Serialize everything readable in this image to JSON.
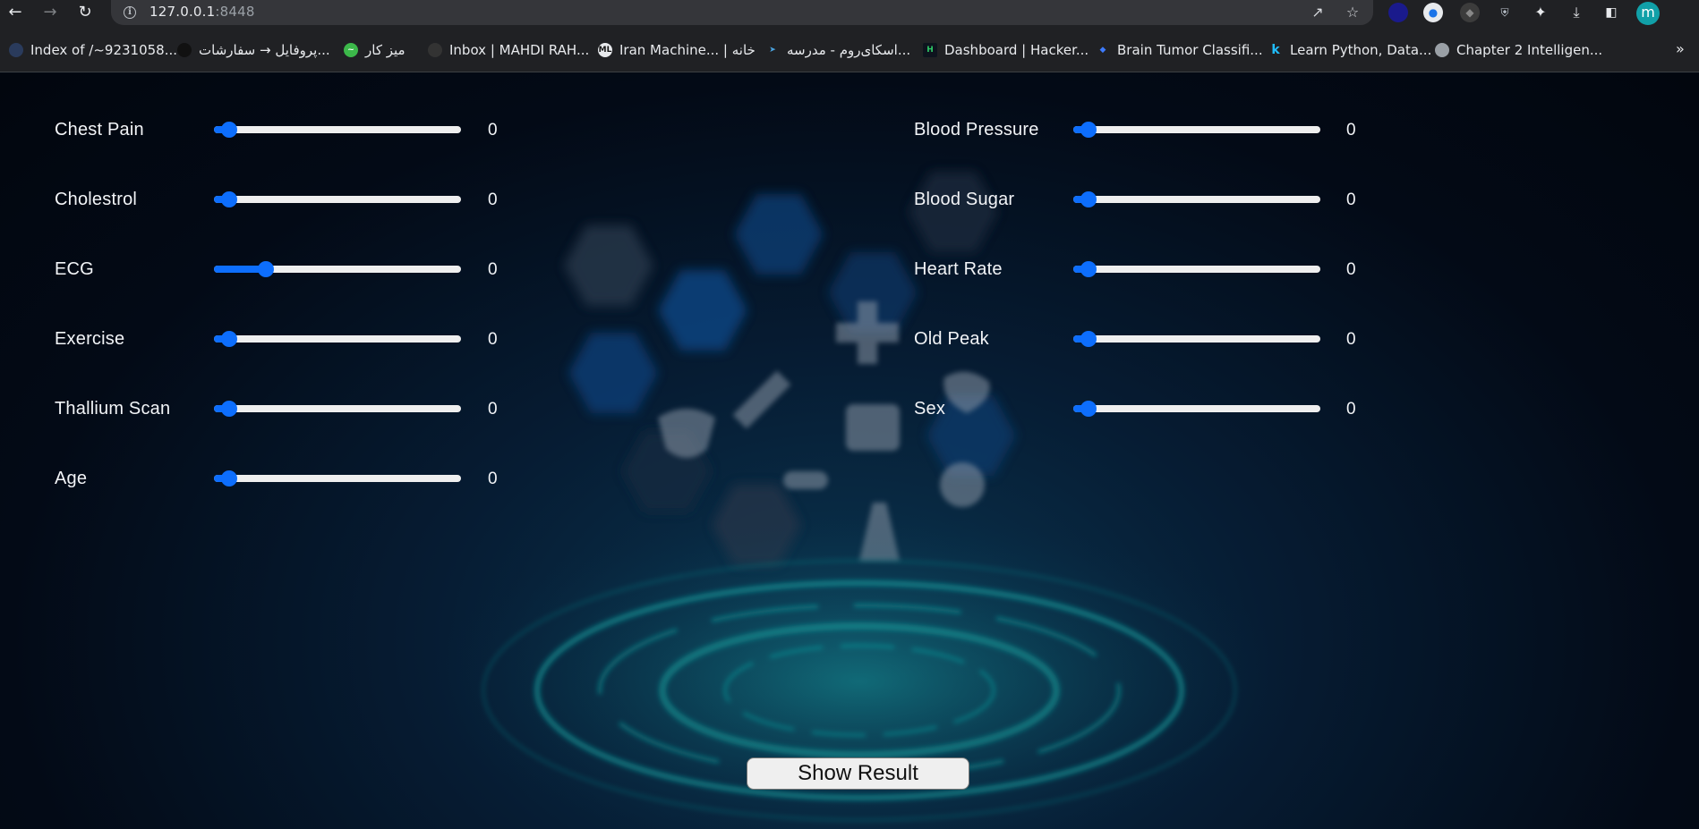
{
  "browser": {
    "url_host": "127.0.0.1",
    "url_port": ":8448",
    "profile_initial": "m",
    "bookmarks": [
      {
        "label": "Index of /~9231058..."
      },
      {
        "label": "پروفایل → سفارشات..."
      },
      {
        "label": "میز کار"
      },
      {
        "label": "Inbox | MAHDI RAH..."
      },
      {
        "label": "Iran Machine... | خانه"
      },
      {
        "label": "اسکای‌روم - مدرسه..."
      },
      {
        "label": "Dashboard | Hacker..."
      },
      {
        "label": "Brain Tumor Classifi..."
      },
      {
        "label": "Learn Python, Data..."
      },
      {
        "label": "Chapter 2 Intelligen..."
      }
    ],
    "more_bookmarks": "»"
  },
  "form": {
    "left_fields": [
      {
        "label": "Chest Pain",
        "value": "0",
        "level": 0.06
      },
      {
        "label": "Cholestrol",
        "value": "0",
        "level": 0.06
      },
      {
        "label": "ECG",
        "value": "0",
        "level": 0.21
      },
      {
        "label": "Exercise",
        "value": "0",
        "level": 0.06
      },
      {
        "label": "Thallium Scan",
        "value": "0",
        "level": 0.06
      },
      {
        "label": "Age",
        "value": "0",
        "level": 0.06
      }
    ],
    "right_fields": [
      {
        "label": "Blood Pressure",
        "value": "0",
        "level": 0.06
      },
      {
        "label": "Blood Sugar",
        "value": "0",
        "level": 0.06
      },
      {
        "label": "Heart Rate",
        "value": "0",
        "level": 0.06
      },
      {
        "label": "Old Peak",
        "value": "0",
        "level": 0.06
      },
      {
        "label": "Sex",
        "value": "0",
        "level": 0.06
      }
    ],
    "submit_label": "Show Result"
  },
  "colors": {
    "accent": "#0d6efd",
    "track": "#efefef",
    "text": "#f2f4f7"
  }
}
